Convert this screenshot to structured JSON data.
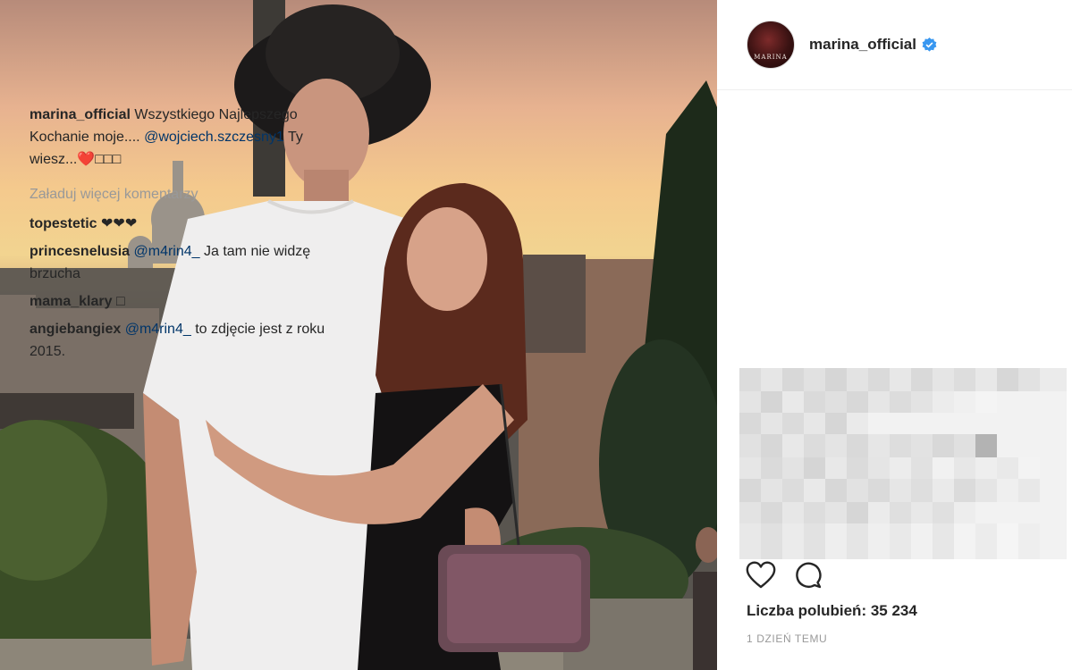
{
  "post": {
    "author": "marina_official",
    "avatar_text": "MARINA",
    "caption": {
      "username": "marina_official",
      "text_1": " Wszystkiego Najlepszego Kochanie moje.... ",
      "mention": "@wojciech.szczesny1",
      "text_2": " Ty wiesz...❤️□□□"
    },
    "load_more": "Załaduj więcej komentarzy",
    "comments": [
      {
        "username": "topestetic",
        "text": " ❤❤❤"
      },
      {
        "username": "princesnelusia",
        "mention": " @m4rin4_",
        "text": "  Ja tam nie widzę brzucha"
      },
      {
        "username": "mama_klary",
        "text": " □"
      },
      {
        "username": "angiebangiex",
        "mention": " @m4rin4_",
        "text": "  to zdjęcie jest z roku 2015."
      }
    ],
    "likes": "Liczba polubień: 35 234",
    "time": "1 DZIEŃ TEMU"
  },
  "colors": {
    "mention": "#003569",
    "verified": "#3897f0",
    "muted": "#999999"
  }
}
